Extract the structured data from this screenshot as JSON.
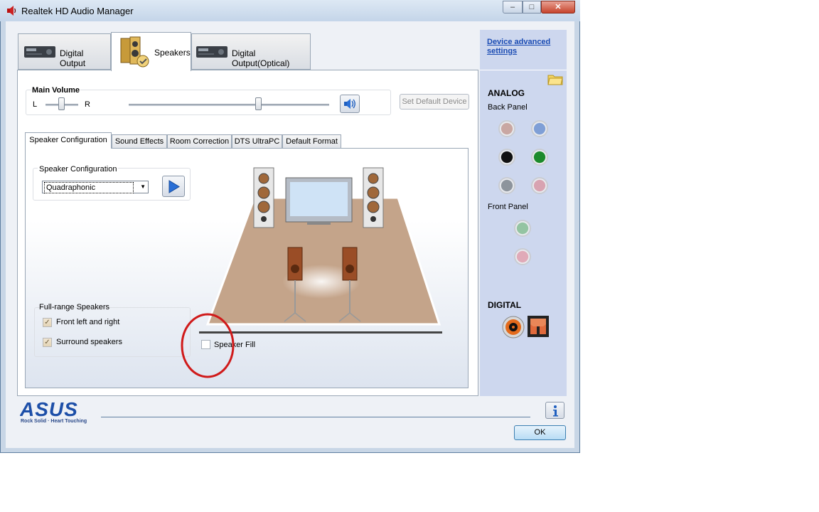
{
  "window": {
    "title": "Realtek HD Audio Manager",
    "minimize": "–",
    "maximize": "□",
    "close": "✕"
  },
  "device_tabs": [
    {
      "label": "Digital Output",
      "icon": "receiver-icon"
    },
    {
      "label": "Speakers",
      "icon": "speakers-icon",
      "selected": true
    },
    {
      "label": "Digital Output(Optical)",
      "icon": "receiver-icon"
    }
  ],
  "main_volume": {
    "title": "Main Volume",
    "left": "L",
    "right": "R",
    "balance": 0.5,
    "level": 0.65
  },
  "set_default_label": "Set Default Device",
  "sub_tabs": [
    "Speaker Configuration",
    "Sound Effects",
    "Room Correction",
    "DTS UltraPC",
    "Default Format"
  ],
  "speaker_config": {
    "title": "Speaker Configuration",
    "selected": "Quadraphonic"
  },
  "full_range": {
    "title": "Full-range Speakers",
    "front": "Front left and right",
    "surround": "Surround speakers"
  },
  "speaker_fill_label": "Speaker Fill",
  "right_panel": {
    "advanced_link": "Device advanced settings",
    "analog": "ANALOG",
    "back_panel": "Back Panel",
    "front_panel": "Front Panel",
    "digital": "DIGITAL",
    "jack_colors": {
      "back": [
        "#c9a7a2",
        "#7f9fd6",
        "#111111",
        "#1c8a2a",
        "#8d949c",
        "#d8a3b1"
      ],
      "front": [
        "#94c4a2",
        "#e0aab8"
      ]
    }
  },
  "footer": {
    "brand": "ASUS",
    "tagline": "Rock Solid · Heart Touching",
    "ok_label": "OK"
  }
}
